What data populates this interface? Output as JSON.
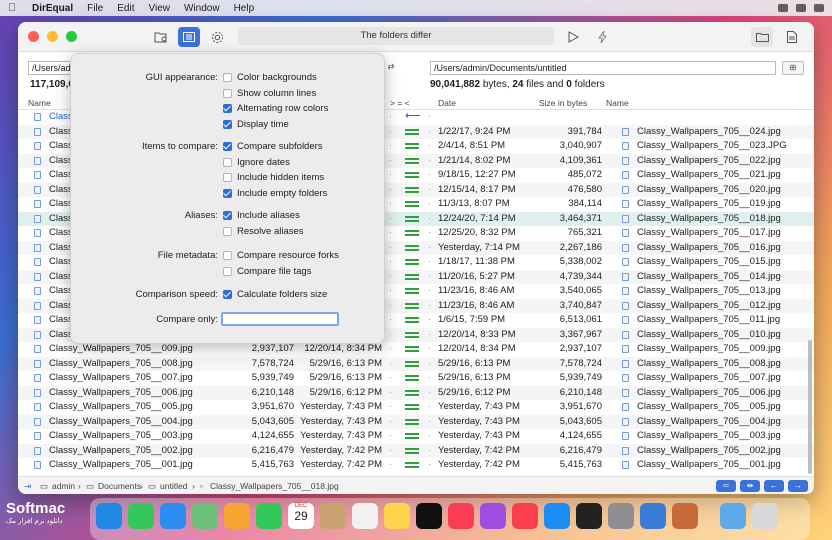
{
  "menubar": {
    "app": "DirEqual",
    "items": [
      "File",
      "Edit",
      "View",
      "Window",
      "Help"
    ]
  },
  "toolbar": {
    "status": "The folders differ"
  },
  "left": {
    "path": "/Users/ad",
    "summary_bytes": "117,109,6"
  },
  "right": {
    "path": "/Users/admin/Documents/untitled",
    "summary_bytes": "90,041,882",
    "summary_bytes_label": "bytes,",
    "summary_files": "24",
    "summary_files_label": "files and",
    "summary_folders": "0",
    "summary_folders_label": "folders"
  },
  "headers": {
    "name": "Name",
    "compare": "> = <",
    "date": "Date",
    "size": "Size in bytes",
    "name2": "Name"
  },
  "popover": {
    "gui_label": "GUI appearance:",
    "gui_opts": [
      {
        "label": "Color backgrounds",
        "checked": false
      },
      {
        "label": "Show column lines",
        "checked": false
      },
      {
        "label": "Alternating row colors",
        "checked": true
      },
      {
        "label": "Display time",
        "checked": true
      }
    ],
    "items_label": "Items to compare:",
    "items_opts": [
      {
        "label": "Compare subfolders",
        "checked": true
      },
      {
        "label": "Ignore dates",
        "checked": false
      },
      {
        "label": "Include hidden items",
        "checked": false
      },
      {
        "label": "Include empty folders",
        "checked": true
      }
    ],
    "aliases_label": "Aliases:",
    "aliases_opts": [
      {
        "label": "Include aliases",
        "checked": true
      },
      {
        "label": "Resolve aliases",
        "checked": false
      }
    ],
    "meta_label": "File metadata:",
    "meta_opts": [
      {
        "label": "Compare resource forks",
        "checked": false
      },
      {
        "label": "Compare file tags",
        "checked": false
      }
    ],
    "speed_label": "Comparison speed:",
    "speed_opts": [
      {
        "label": "Calculate folders size",
        "checked": true
      }
    ],
    "only_label": "Compare only:"
  },
  "rows": [
    {
      "ln": "Classy",
      "lsize": "",
      "ldate": "",
      "cmp": "arrow",
      "rdate": "",
      "rsize": "",
      "rname": ""
    },
    {
      "ln": "Class",
      "lsize": "",
      "ldate": "",
      "cmp": "eq",
      "rdate": "1/22/17, 9:24 PM",
      "rsize": "391,784",
      "rname": "Classy_Wallpapers_705__024.jpg"
    },
    {
      "ln": "Class",
      "lsize": "",
      "ldate": "",
      "cmp": "eq",
      "rdate": "2/4/14, 8:51 PM",
      "rsize": "3,040,907",
      "rname": "Classy_Wallpapers_705__023.JPG"
    },
    {
      "ln": "Class",
      "lsize": "",
      "ldate": "",
      "cmp": "eq",
      "rdate": "1/21/14, 8:02 PM",
      "rsize": "4,109,361",
      "rname": "Classy_Wallpapers_705__022.jpg"
    },
    {
      "ln": "Class",
      "lsize": "",
      "ldate": "M",
      "cmp": "eq",
      "rdate": "9/18/15, 12:27 PM",
      "rsize": "485,072",
      "rname": "Classy_Wallpapers_705__021.jpg"
    },
    {
      "ln": "Class",
      "lsize": "",
      "ldate": "M",
      "cmp": "eq",
      "rdate": "12/15/14, 8:17 PM",
      "rsize": "476,580",
      "rname": "Classy_Wallpapers_705__020.jpg"
    },
    {
      "ln": "Class",
      "lsize": "",
      "ldate": "",
      "cmp": "eq",
      "rdate": "11/3/13, 8:07 PM",
      "rsize": "384,114",
      "rname": "Classy_Wallpapers_705__019.jpg"
    },
    {
      "ln": "Class",
      "lsize": "",
      "ldate": "M",
      "cmp": "eq",
      "rdate": "12/24/20, 7:14 PM",
      "rsize": "3,464,371",
      "rname": "Classy_Wallpapers_705__018.jpg"
    },
    {
      "ln": "Class",
      "lsize": "",
      "ldate": "M",
      "cmp": "eq",
      "rdate": "12/25/20, 8:32 PM",
      "rsize": "765,321",
      "rname": "Classy_Wallpapers_705__017.jpg"
    },
    {
      "ln": "Class",
      "lsize": "",
      "ldate": "PM",
      "cmp": "eq",
      "rdate": "Yesterday, 7:14 PM",
      "rsize": "2,267,186",
      "rname": "Classy_Wallpapers_705__016.jpg"
    },
    {
      "ln": "Class",
      "lsize": "",
      "ldate": "",
      "cmp": "eq",
      "rdate": "1/18/17, 11:38 PM",
      "rsize": "5,338,002",
      "rname": "Classy_Wallpapers_705__015.jpg"
    },
    {
      "ln": "Class",
      "lsize": "",
      "ldate": "M",
      "cmp": "eq",
      "rdate": "11/20/16, 5:27 PM",
      "rsize": "4,739,344",
      "rname": "Classy_Wallpapers_705__014.jpg"
    },
    {
      "ln": "Class",
      "lsize": "",
      "ldate": "M",
      "cmp": "eq",
      "rdate": "11/23/16, 8:46 AM",
      "rsize": "3,540,065",
      "rname": "Classy_Wallpapers_705__013.jpg"
    },
    {
      "ln": "Class",
      "lsize": "",
      "ldate": "M",
      "cmp": "eq",
      "rdate": "11/23/16, 8:46 AM",
      "rsize": "3,740,847",
      "rname": "Classy_Wallpapers_705__012.jpg"
    },
    {
      "ln": "Class",
      "lsize": "",
      "ldate": "",
      "cmp": "eq",
      "rdate": "1/6/15, 7:59 PM",
      "rsize": "6,513,061",
      "rname": "Classy_Wallpapers_705__011.jpg"
    },
    {
      "ln": "Class",
      "lsize": "",
      "ldate": "M",
      "cmp": "eq",
      "rdate": "12/20/14, 8:33 PM",
      "rsize": "3,367,967",
      "rname": "Classy_Wallpapers_705__010.jpg"
    },
    {
      "ln": "Classy_Wallpapers_705__009.jpg",
      "lsize": "2,937,107",
      "ldate": "12/20/14, 8:34 PM",
      "cmp": "eq",
      "rdate": "12/20/14, 8:34 PM",
      "rsize": "2,937,107",
      "rname": "Classy_Wallpapers_705__009.jpg"
    },
    {
      "ln": "Classy_Wallpapers_705__008.jpg",
      "lsize": "7,578,724",
      "ldate": "5/29/16, 6:13 PM",
      "cmp": "eq",
      "rdate": "5/29/16, 6:13 PM",
      "rsize": "7,578,724",
      "rname": "Classy_Wallpapers_705__008.jpg"
    },
    {
      "ln": "Classy_Wallpapers_705__007.jpg",
      "lsize": "5,939,749",
      "ldate": "5/29/16, 6:13 PM",
      "cmp": "eq",
      "rdate": "5/29/16, 6:13 PM",
      "rsize": "5,939,749",
      "rname": "Classy_Wallpapers_705__007.jpg"
    },
    {
      "ln": "Classy_Wallpapers_705__006.jpg",
      "lsize": "6,210,148",
      "ldate": "5/29/16, 6:12 PM",
      "cmp": "eq",
      "rdate": "5/29/16, 6:12 PM",
      "rsize": "6,210,148",
      "rname": "Classy_Wallpapers_705__006.jpg"
    },
    {
      "ln": "Classy_Wallpapers_705__005.jpg",
      "lsize": "3,951,670",
      "ldate": "Yesterday, 7:43 PM",
      "cmp": "eq",
      "rdate": "Yesterday, 7:43 PM",
      "rsize": "3,951,670",
      "rname": "Classy_Wallpapers_705__005.jpg"
    },
    {
      "ln": "Classy_Wallpapers_705__004.jpg",
      "lsize": "5,043,605",
      "ldate": "Yesterday, 7:43 PM",
      "cmp": "eq",
      "rdate": "Yesterday, 7:43 PM",
      "rsize": "5,043,605",
      "rname": "Classy_Wallpapers_705__004.jpg"
    },
    {
      "ln": "Classy_Wallpapers_705__003.jpg",
      "lsize": "4,124,655",
      "ldate": "Yesterday, 7:43 PM",
      "cmp": "eq",
      "rdate": "Yesterday, 7:43 PM",
      "rsize": "4,124,655",
      "rname": "Classy_Wallpapers_705__003.jpg"
    },
    {
      "ln": "Classy_Wallpapers_705__002.jpg",
      "lsize": "6,216,479",
      "ldate": "Yesterday, 7:42 PM",
      "cmp": "eq",
      "rdate": "Yesterday, 7:42 PM",
      "rsize": "6,216,479",
      "rname": "Classy_Wallpapers_705__002.jpg"
    },
    {
      "ln": "Classy_Wallpapers_705__001.jpg",
      "lsize": "5,415,763",
      "ldate": "Yesterday, 7:42 PM",
      "cmp": "eq",
      "rdate": "Yesterday, 7:42 PM",
      "rsize": "5,415,763",
      "rname": "Classy_Wallpapers_705__001.jpg"
    }
  ],
  "selected_row": 7,
  "breadcrumb": [
    "admin",
    "Documents",
    "untitled",
    "Classy_Wallpapers_705__018.jpg"
  ],
  "dock": {
    "calendar_month": "DEC",
    "calendar_day": "29"
  },
  "watermark": {
    "brand": "Softmac",
    "subtitle": "دانلود نرم افزار مک"
  }
}
